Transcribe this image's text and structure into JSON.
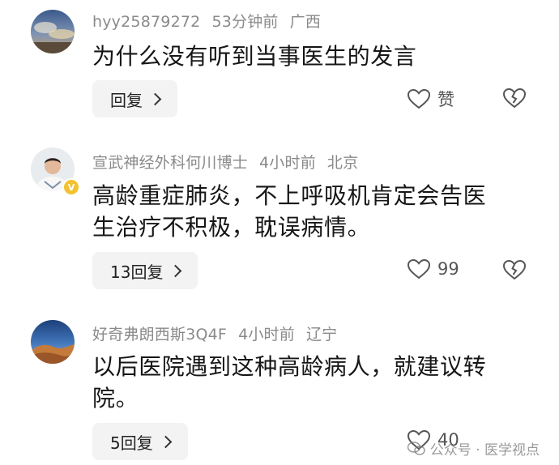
{
  "comments": [
    {
      "username": "hyy25879272",
      "time": "53分钟前",
      "location": "广西",
      "text": "为什么没有听到当事医生的发言",
      "reply_label": "回复",
      "like_label": "赞",
      "avatar": "dusk-sky-landscape"
    },
    {
      "username": "宣武神经外科何川博士",
      "time": "4小时前",
      "location": "北京",
      "text_line1": "高龄重症肺炎，不上呼吸机肯定会告医",
      "text_line2": "生治疗不积极，耽误病情。",
      "reply_label": "13回复",
      "like_label": "99",
      "avatar": "doctor-portrait-verified"
    },
    {
      "username": "好奇弗朗西斯3Q4F",
      "time": "4小时前",
      "location": "辽宁",
      "text_line1": "以后医院遇到这种高龄病人，就建议转",
      "text_line2": "院。",
      "reply_label": "5回复",
      "like_label": "40",
      "avatar": "desert-dunes-landscape"
    }
  ],
  "watermark": {
    "text": "公众号 · 医学视点"
  },
  "icons": {
    "like": "heart-outline-icon",
    "dislike": "broken-heart-icon",
    "reply_chevron": "chevron-right-icon"
  },
  "colors": {
    "meta_text": "#8a8a8a",
    "body_text": "#161616",
    "reply_bg": "#f3f3f3",
    "verified_badge": "#f2c230"
  }
}
